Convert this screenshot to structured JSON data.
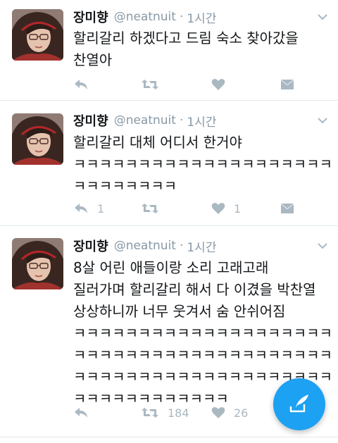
{
  "tweets": [
    {
      "name": "장미향",
      "handle": "@neatnuit",
      "separator": "·",
      "time": "1시간",
      "text": "할리갈리 하겠다고 드림 숙소 찾아갔을\n찬열아",
      "reply_count": "",
      "retweet_count": "",
      "like_count": ""
    },
    {
      "name": "장미향",
      "handle": "@neatnuit",
      "separator": "·",
      "time": "1시간",
      "text": "할리갈리 대체 어디서 한거야\nㅋㅋㅋㅋㅋㅋㅋㅋㅋㅋㅋㅋㅋㅋㅋㅋㅋㅋㅋㅋ\nㅋㅋㅋㅋㅋㅋㅋㅋ",
      "reply_count": "1",
      "retweet_count": "",
      "like_count": "1"
    },
    {
      "name": "장미향",
      "handle": "@neatnuit",
      "separator": "·",
      "time": "1시간",
      "text": "8살 어린 애들이랑 소리 고래고래\n질러가며 할리갈리 해서 다 이겼을 박찬열\n상상하니까 너무 웃겨서 숨 안쉬어짐\nㅋㅋㅋㅋㅋㅋㅋㅋㅋㅋㅋㅋㅋㅋㅋㅋㅋㅋㅋㅋ\nㅋㅋㅋㅋㅋㅋㅋㅋㅋㅋㅋㅋㅋㅋㅋㅋㅋㅋㅋㅋ\nㅋㅋㅋㅋㅋㅋㅋㅋㅋㅋㅋㅋㅋㅋㅋㅋㅋㅋㅋㅋ\nㅋㅋㅋㅋㅋㅋㅋㅋㅋㅋㅋㅋ",
      "reply_count": "",
      "retweet_count": "184",
      "like_count": "26"
    }
  ],
  "icons": {
    "reply": "reply-icon",
    "retweet": "retweet-icon",
    "like": "heart-icon",
    "dm": "envelope-icon",
    "caret": "chevron-down-icon",
    "compose": "compose-tweet-icon"
  },
  "colors": {
    "accent": "#1da1f2",
    "muted": "#8899a6",
    "icon": "#aab8c2",
    "divider": "#e1e8ed",
    "text": "#14171a"
  }
}
